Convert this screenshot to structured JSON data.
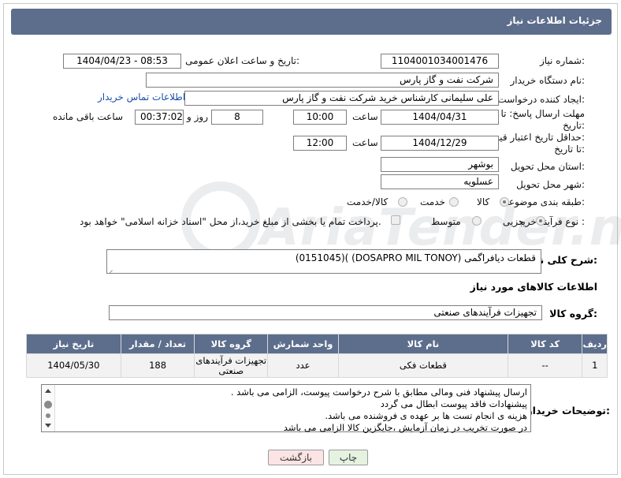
{
  "header": {
    "title": "جزئیات اطلاعات نیاز"
  },
  "watermark": {
    "text": "AriaTender.neT"
  },
  "fields": {
    "need_number_label": "شماره نیاز:",
    "need_number": "1104001034001476",
    "announce_label": "تاریخ و ساعت اعلان عمومی:",
    "announce_value": "1404/04/23 - 08:53",
    "buyer_org_label": "نام دستگاه خریدار:",
    "buyer_org": "شرکت نفت و گاز پارس",
    "requester_label": "ایجاد کننده درخواست:",
    "requester": "علی سلیمانی کارشناس خرید شرکت نفت و گاز پارس",
    "contact_link": "اطلاعات تماس خریدار",
    "deadline_label_1": "مهلت ارسال پاسخ: تا",
    "deadline_label_2": "تاریخ:",
    "deadline_date": "1404/04/31",
    "time_label": "ساعت",
    "deadline_time": "10:00",
    "days_value": "8",
    "days_label": "روز و",
    "remaining_value": "00:37:02",
    "remaining_label": "ساعت باقی مانده",
    "min_price_label_1": "حداقل تاریخ اعتبار قیمت:",
    "min_price_label_2": "تا تاریخ:",
    "min_price_date": "1404/12/29",
    "min_price_time": "12:00",
    "province_label": "استان محل تحویل:",
    "province": "بوشهر",
    "city_label": "شهر محل تحویل:",
    "city": "عسلویه",
    "category_label": "طبقه بندی موضوعی:",
    "category_options": [
      "کالا",
      "خدمت",
      "کالا/خدمت"
    ],
    "process_label": "نوع فرآیند خرید :",
    "process_options": [
      "جزیی",
      "متوسط"
    ],
    "payment_text": "پرداخت تمام یا بخشی از مبلغ خرید،از محل \"اسناد خزانه اسلامی\" خواهد بود.",
    "description_label": "شرح کلی نیاز:",
    "description": "قطعات دیافراگمی (DOSAPRO MIL TONOY) )(0151045)"
  },
  "goods": {
    "section_title": "اطلاعات کالاهای مورد نیاز",
    "group_label": "گروه کالا:",
    "group_value": "تجهیزات فرآیندهای صنعتی",
    "columns": [
      "ردیف",
      "کد کالا",
      "نام کالا",
      "واحد شمارش",
      "گروه کالا",
      "تعداد / مقدار",
      "تاریخ نیاز"
    ],
    "rows": [
      [
        "1",
        "--",
        "قطعات فکی",
        "عدد",
        "تجهیزات فرآیندهای صنعتی",
        "188",
        "1404/05/30"
      ]
    ]
  },
  "notes": {
    "label": "توضیحات خریدار:",
    "lines": [
      "ارسال پیشنهاد فنی ومالی مطابق با شرح درخواست پیوست، الزامی می باشد .",
      "پیشنهادات فاقد پیوست ابطال می گردد",
      "هزینه ی انجام تست ها بر عهده ی فروشنده می باشد.",
      "در صورت تخریب در زمان آزمایش ،جایگزین کالا الزامی می باشد"
    ]
  },
  "buttons": {
    "print": "چاپ",
    "back": "بازگشت"
  },
  "colors": {
    "header_bg": "#5d6d8c",
    "link": "#1a4fa8",
    "back_bg": "#fbe4e4",
    "print_bg": "#e6f2e0"
  }
}
